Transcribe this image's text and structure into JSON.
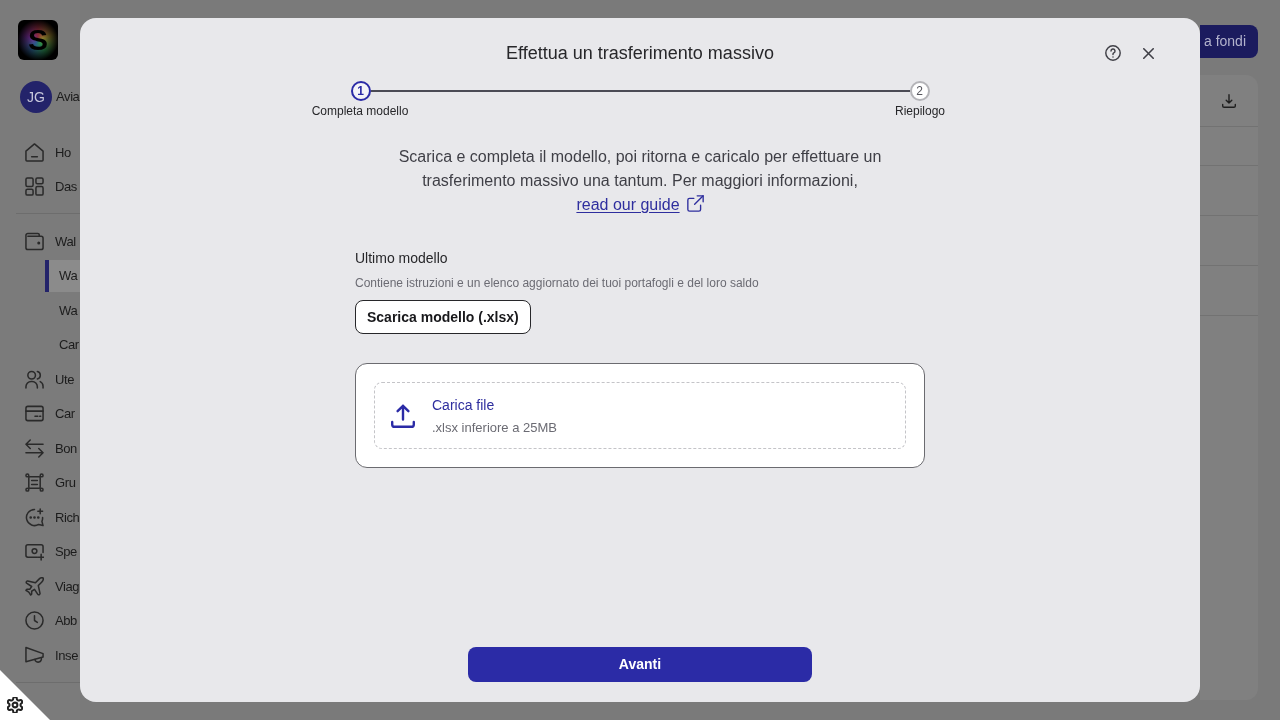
{
  "sidebar": {
    "logo": {
      "letter": "S"
    },
    "user": {
      "initials": "JG",
      "name": "Avia"
    },
    "sections": [
      {
        "items": [
          {
            "label": "Ho",
            "selected": false
          },
          {
            "label": "Das",
            "selected": false
          }
        ]
      },
      {
        "items": [
          {
            "label": "Wal",
            "selected": false,
            "children": [
              {
                "label": "Wa",
                "selected": true
              },
              {
                "label": "Wa",
                "selected": false
              },
              {
                "label": "Car",
                "selected": false
              }
            ]
          },
          {
            "label": "Ute",
            "selected": false
          },
          {
            "label": "Car",
            "selected": false
          },
          {
            "label": "Bon",
            "selected": false
          },
          {
            "label": "Gru",
            "selected": false
          },
          {
            "label": "Rich",
            "selected": false
          },
          {
            "label": "Spe",
            "selected": false
          },
          {
            "label": "Viag",
            "selected": false
          },
          {
            "label": "Abb",
            "selected": false
          },
          {
            "label": "Inse",
            "selected": false
          }
        ]
      }
    ]
  },
  "header_button": {
    "label": "a fondi"
  },
  "dialog": {
    "title": "Effettua un trasferimento massivo",
    "steps": [
      {
        "number": "1",
        "label": "Completa modello",
        "current": true
      },
      {
        "number": "2",
        "label": "Riepilogo",
        "current": false
      }
    ],
    "description": "Scarica e completa il modello, poi ritorna e caricalo per effettuare un trasferimento massivo una tantum. Per maggiori informazioni,",
    "guide_link": "read our guide",
    "template": {
      "title": "Ultimo modello",
      "subtitle": "Contiene istruzioni e un elenco aggiornato dei tuoi portafogli e del loro saldo",
      "button": "Scarica modello (.xlsx)"
    },
    "upload": {
      "title": "Carica file",
      "hint": ".xlsx inferiore a 25MB"
    },
    "next_button": "Avanti"
  }
}
